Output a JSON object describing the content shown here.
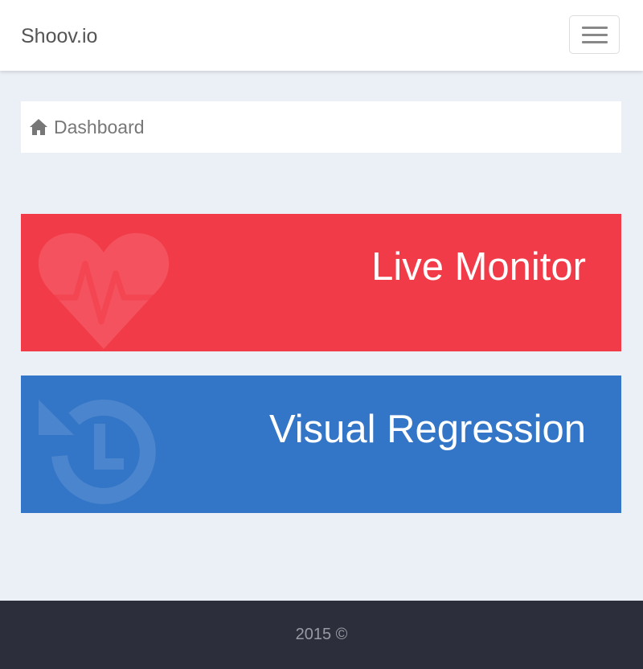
{
  "navbar": {
    "brand": "Shoov.io",
    "menu_icon": "hamburger-icon"
  },
  "breadcrumb": {
    "icon": "home-icon",
    "label": "Dashboard"
  },
  "tiles": [
    {
      "title": "Live Monitor",
      "icon": "heartbeat-icon",
      "color": "#f23b48"
    },
    {
      "title": "Visual Regression",
      "icon": "history-icon",
      "color": "#3375c6"
    }
  ],
  "footer": {
    "text": "2015 ©"
  },
  "colors": {
    "page_background": "#ebeff6",
    "footer_background": "#2c2f3b"
  }
}
